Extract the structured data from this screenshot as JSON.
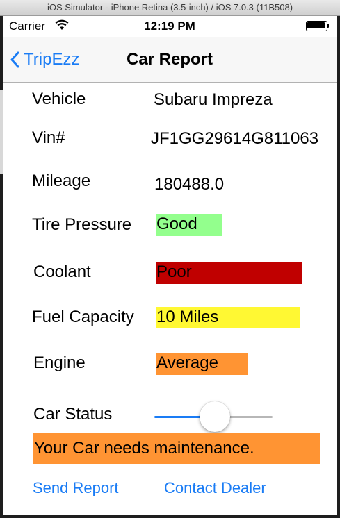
{
  "window": {
    "title": "iOS Simulator - iPhone Retina (3.5-inch) / iOS 7.0.3 (11B508)"
  },
  "status_bar": {
    "carrier": "Carrier",
    "time": "12:19 PM",
    "battery_level": 1.0
  },
  "nav_bar": {
    "back_label": "TripEzz",
    "title": "Car Report"
  },
  "vehicle": {
    "label": "Vehicle",
    "value": "Subaru Impreza"
  },
  "vin": {
    "label": "Vin#",
    "value": "JF1GG29614G811063"
  },
  "mileage": {
    "label": "Mileage",
    "value": "180488.0"
  },
  "tire_pressure": {
    "label": "Tire Pressure",
    "value": "Good",
    "color": "#93ff8d"
  },
  "coolant": {
    "label": "Coolant",
    "value": "Poor",
    "color": "#c00000"
  },
  "fuel_capacity": {
    "label": "Fuel Capacity",
    "value": "10 Miles",
    "color": "#fff833"
  },
  "engine": {
    "label": "Engine",
    "value": "Average",
    "color": "#ff9433"
  },
  "car_status": {
    "label": "Car Status",
    "slider_fraction": 0.5
  },
  "banner": {
    "message": "Your Car needs maintenance.",
    "color": "#ff9433"
  },
  "actions": {
    "send_report": "Send Report",
    "contact_dealer": "Contact Dealer"
  },
  "colors": {
    "accent": "#1a7cf5"
  }
}
